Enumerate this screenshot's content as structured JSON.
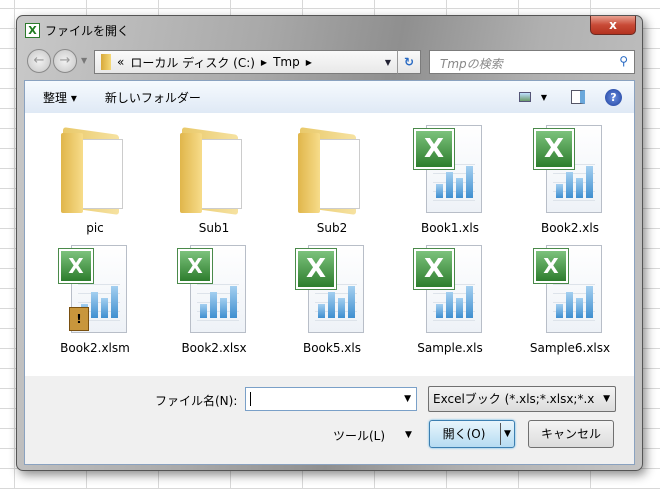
{
  "window": {
    "title": "ファイルを開く",
    "close": "x"
  },
  "nav": {
    "back": "←",
    "forward": "→",
    "breadcrumb": [
      "«",
      "ローカル ディスク (C:)",
      "Tmp"
    ],
    "refresh": "↻",
    "search_placeholder": "Tmpの検索"
  },
  "toolbar": {
    "organize": "整理 ▾",
    "new_folder": "新しいフォルダー",
    "help": "?"
  },
  "files": [
    {
      "name": "pic",
      "type": "folder"
    },
    {
      "name": "Sub1",
      "type": "folder"
    },
    {
      "name": "Sub2",
      "type": "folder"
    },
    {
      "name": "Book1.xls",
      "type": "xls"
    },
    {
      "name": "Book2.xls",
      "type": "xls"
    },
    {
      "name": "Book2.xlsm",
      "type": "xlsm"
    },
    {
      "name": "Book2.xlsx",
      "type": "xlsx"
    },
    {
      "name": "Book5.xls",
      "type": "xls"
    },
    {
      "name": "Sample.xls",
      "type": "xls"
    },
    {
      "name": "Sample6.xlsx",
      "type": "xlsx"
    }
  ],
  "bottom": {
    "filename_label": "ファイル名(N):",
    "filename_value": "",
    "filetype": "Excelブック (*.xls;*.xlsx;*.x",
    "tools": "ツール(L)",
    "open": "開く(O)",
    "cancel": "キャンセル"
  }
}
